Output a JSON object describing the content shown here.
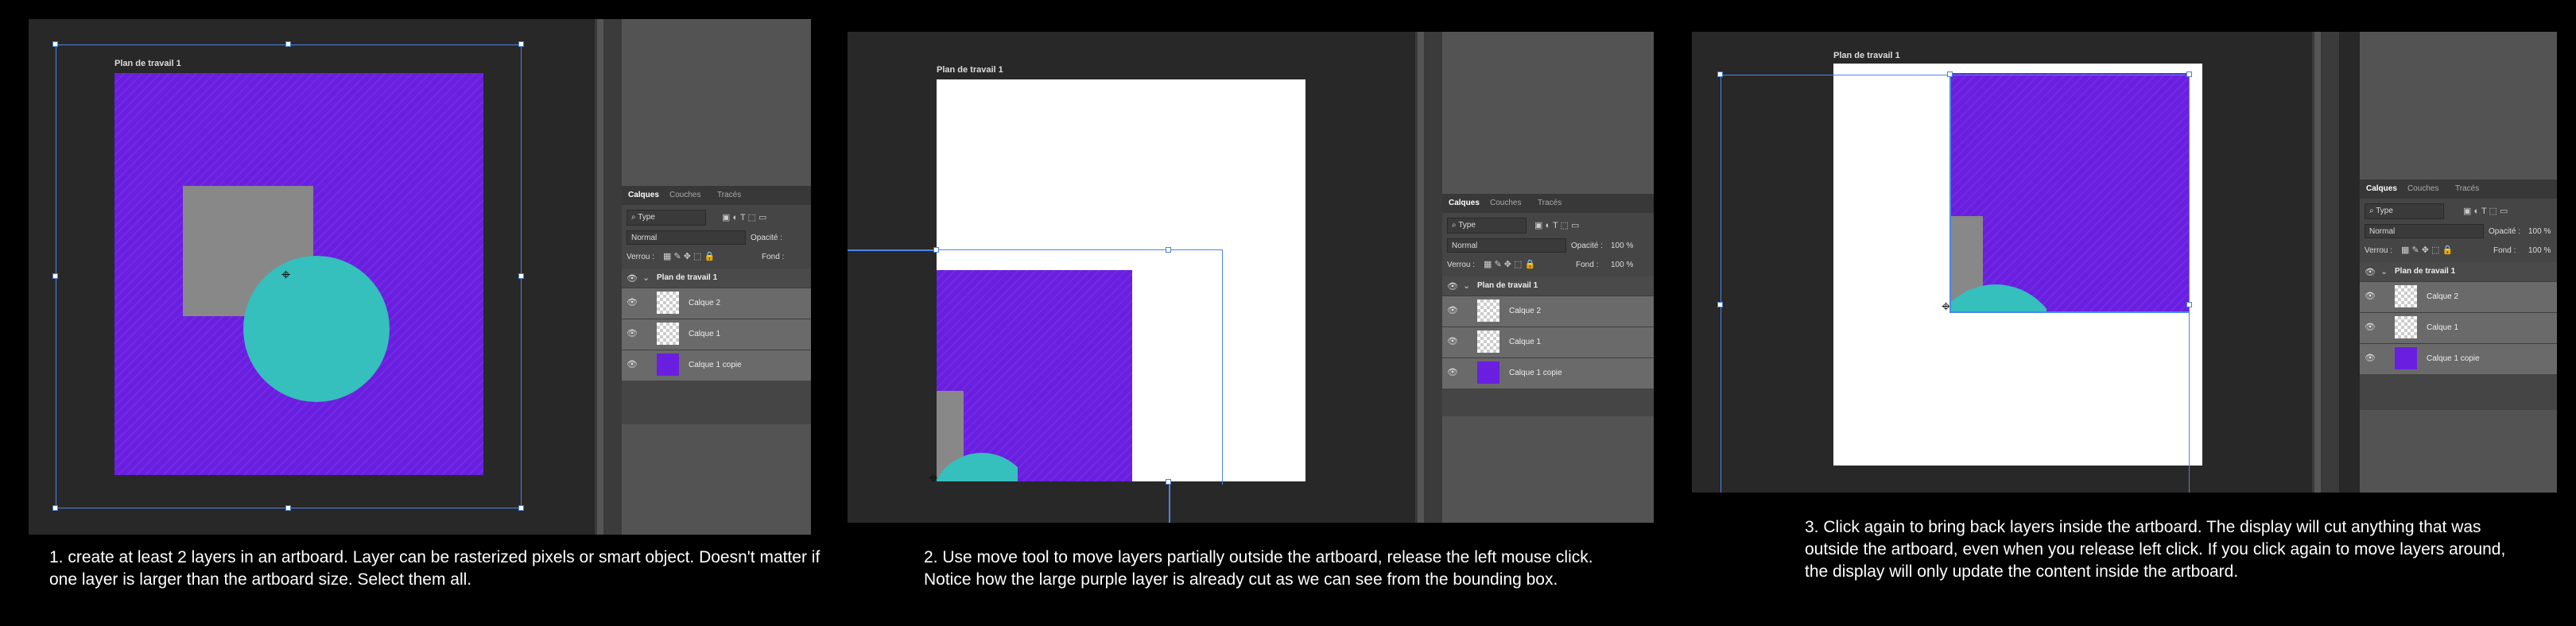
{
  "panel1": {
    "artboard_label": "Plan de travail 1",
    "caption": "1. create at least 2 layers in an artboard. Layer can be rasterized pixels or smart object. Doesn't matter if one layer is larger than the artboard size. Select them all."
  },
  "panel2": {
    "artboard_label": "Plan de travail 1",
    "caption": "2. Use move tool to move layers partially outside the artboard, release the left mouse click. Notice how the large purple layer is already cut as we can see from the bounding box."
  },
  "panel3": {
    "artboard_label": "Plan de travail 1",
    "caption": "3. Click again to bring back layers inside the artboard. The display will cut anything that was outside the artboard, even when you release left click. If you click again to move layers around, the display will only update the content inside the artboard."
  },
  "layers_panel": {
    "tabs": [
      "Calques",
      "Couches",
      "Tracés"
    ],
    "filter_type": "Type",
    "blend_mode": "Normal",
    "opacity_label": "Opacité :",
    "opacity_value": "100 %",
    "lock_label": "Verrou :",
    "fill_label": "Fond :",
    "fill_value": "100 %",
    "group_name": "Plan de travail 1",
    "layers": [
      "Calque 2",
      "Calque 1",
      "Calque 1 copie"
    ]
  },
  "colors": {
    "purple": "#6a1fe0",
    "teal": "#35bfbd",
    "gray": "#888888",
    "selection_blue": "#4a86e8"
  },
  "icons": [
    "eye-icon",
    "search-icon",
    "chevron-down-icon",
    "lock-icon",
    "target-crosshair-icon"
  ]
}
